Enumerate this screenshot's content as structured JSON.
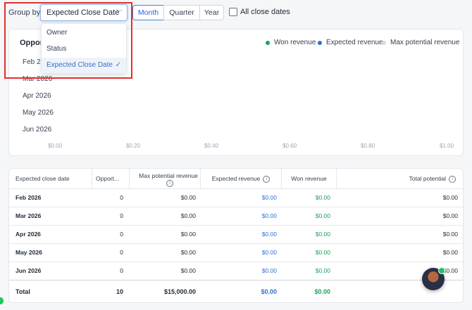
{
  "toolbar": {
    "group_by_label": "Group by",
    "group_by_value": "Expected Close Date",
    "periods": [
      "Month",
      "Quarter",
      "Year"
    ],
    "active_period": "Month",
    "all_close_dates_label": "All close dates",
    "all_close_dates_checked": false
  },
  "dropdown": {
    "options": [
      "Owner",
      "Status",
      "Expected Close Date"
    ],
    "selected": "Expected Close Date"
  },
  "chart": {
    "title_visible": "Oppor",
    "legend": [
      {
        "label": "Won revenue",
        "color": "#19a35a"
      },
      {
        "label": "Expected revenue",
        "color": "#2f6fd6"
      },
      {
        "label": "Max potential revenue",
        "color": "#d9dde3"
      }
    ]
  },
  "chart_data": {
    "type": "bar",
    "orientation": "horizontal",
    "categories": [
      "Feb 2026",
      "Mar 2026",
      "Apr 2026",
      "May 2026",
      "Jun 2026"
    ],
    "series": [
      {
        "name": "Won revenue",
        "values": [
          0,
          0,
          0,
          0,
          0
        ]
      },
      {
        "name": "Expected revenue",
        "values": [
          0,
          0,
          0,
          0,
          0
        ]
      },
      {
        "name": "Max potential revenue",
        "values": [
          0,
          0,
          0,
          0,
          0
        ]
      }
    ],
    "x_ticks": [
      "$0.00",
      "$0.20",
      "$0.40",
      "$0.60",
      "$0.80",
      "$1.00"
    ],
    "xlim": [
      0,
      1
    ]
  },
  "table": {
    "headers": [
      "Expected close date",
      "Opport...",
      "Max potential revenue",
      "Expected revenue",
      "Won revenue",
      "Total potential"
    ],
    "rows": [
      {
        "date": "Feb 2026",
        "count": "0",
        "max": "$0.00",
        "expected": "$0.00",
        "won": "$0.00",
        "total": "$0.00"
      },
      {
        "date": "Mar 2026",
        "count": "0",
        "max": "$0.00",
        "expected": "$0.00",
        "won": "$0.00",
        "total": "$0.00"
      },
      {
        "date": "Apr 2026",
        "count": "0",
        "max": "$0.00",
        "expected": "$0.00",
        "won": "$0.00",
        "total": "$0.00"
      },
      {
        "date": "May 2026",
        "count": "0",
        "max": "$0.00",
        "expected": "$0.00",
        "won": "$0.00",
        "total": "$0.00"
      },
      {
        "date": "Jun 2026",
        "count": "0",
        "max": "$0.00",
        "expected": "$0.00",
        "won": "$0.00",
        "total": "$0.00"
      }
    ],
    "total": {
      "label": "Total",
      "count": "10",
      "max": "$15,000.00",
      "expected": "$0.00",
      "won": "$0.00",
      "total": ""
    }
  },
  "icons": {
    "info": "i",
    "chevron": "﹀",
    "check": "✓"
  }
}
